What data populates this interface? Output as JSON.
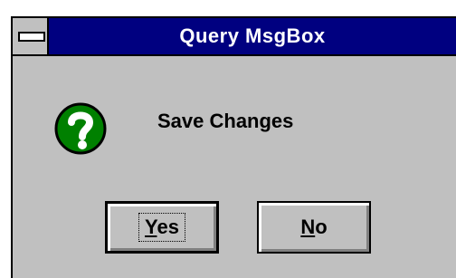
{
  "window": {
    "title": "Query MsgBox"
  },
  "dialog": {
    "icon": "question-icon",
    "message": "Save Changes",
    "buttons": {
      "yes": {
        "mnemonic": "Y",
        "rest": "es"
      },
      "no": {
        "mnemonic": "N",
        "rest": "o"
      }
    }
  },
  "colors": {
    "titlebar": "#000080",
    "face": "#c0c0c0",
    "icon_green": "#008000"
  }
}
